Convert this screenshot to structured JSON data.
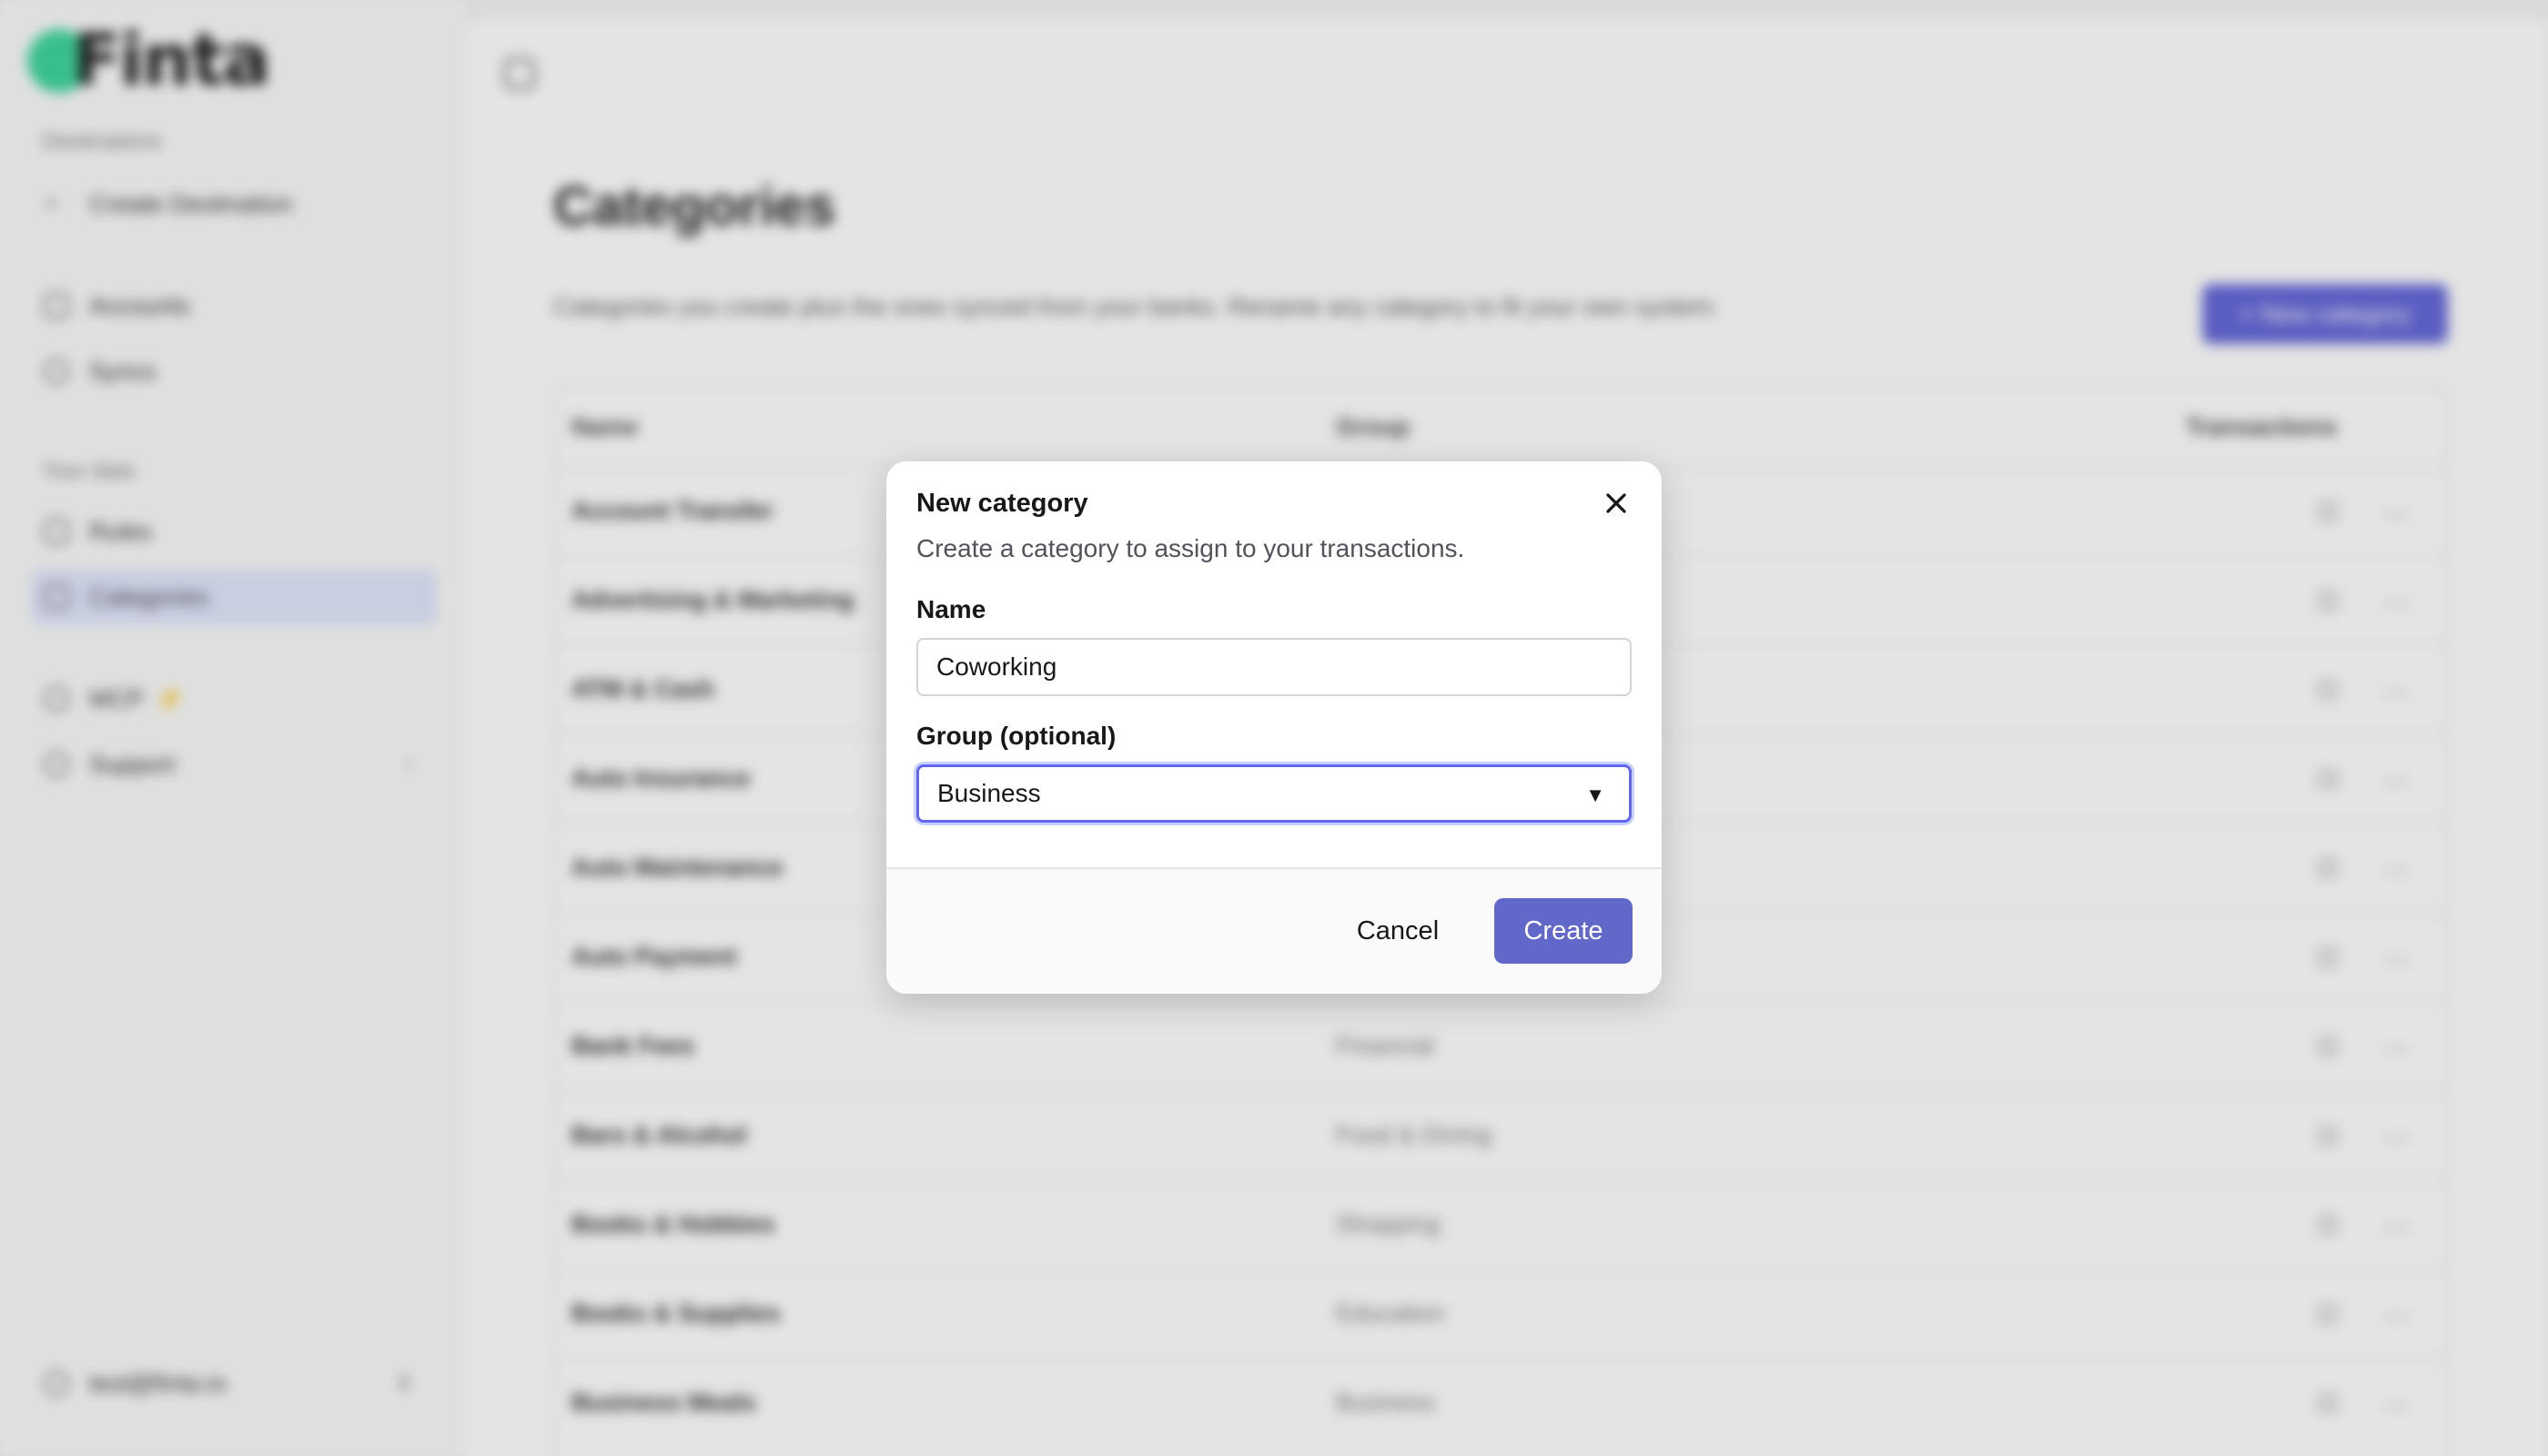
{
  "brand": {
    "name": "Finta"
  },
  "sidebar": {
    "sections": [
      {
        "heading": "Destinations",
        "items": [
          {
            "label": "Create Destination",
            "icon": "plus-icon"
          }
        ]
      },
      {
        "heading": "",
        "items": [
          {
            "label": "Accounts",
            "icon": "bank-icon"
          },
          {
            "label": "Syncs",
            "icon": "sync-icon"
          }
        ]
      },
      {
        "heading": "Your data",
        "items": [
          {
            "label": "Rules",
            "icon": "rules-icon"
          },
          {
            "label": "Categories",
            "icon": "tag-icon",
            "active": true
          }
        ]
      },
      {
        "heading": "",
        "items": [
          {
            "label": "MCP",
            "icon": "mcp-icon",
            "badge": "⚡"
          },
          {
            "label": "Support",
            "icon": "support-icon",
            "trail": "›"
          }
        ]
      }
    ],
    "user": {
      "email": "test@finta.io"
    }
  },
  "main": {
    "title": "Categories",
    "description": "Categories you create plus the ones synced from your banks. Rename any category to fit your own system.",
    "new_button": "+ New category",
    "table": {
      "columns": [
        "Name",
        "Group",
        "Transactions"
      ],
      "rows": [
        {
          "name": "Account Transfer",
          "group": ""
        },
        {
          "name": "Advertising & Marketing",
          "group": ""
        },
        {
          "name": "ATM & Cash",
          "group": ""
        },
        {
          "name": "Auto Insurance",
          "group": ""
        },
        {
          "name": "Auto Maintenance",
          "group": ""
        },
        {
          "name": "Auto Payment",
          "group": ""
        },
        {
          "name": "Bank Fees",
          "group": "Financial"
        },
        {
          "name": "Bars & Alcohol",
          "group": "Food & Dining"
        },
        {
          "name": "Books & Hobbies",
          "group": "Shopping"
        },
        {
          "name": "Books & Supplies",
          "group": "Education"
        },
        {
          "name": "Business Meals",
          "group": "Business"
        }
      ]
    }
  },
  "modal": {
    "title": "New category",
    "description": "Create a category to assign to your transactions.",
    "name_label": "Name",
    "name_value": "Coworking",
    "group_label": "Group (optional)",
    "group_value": "Business",
    "cancel_label": "Cancel",
    "create_label": "Create"
  },
  "colors": {
    "accent": "#6268c9",
    "focus_ring": "#6366f1",
    "brand_green": "#34d399"
  }
}
